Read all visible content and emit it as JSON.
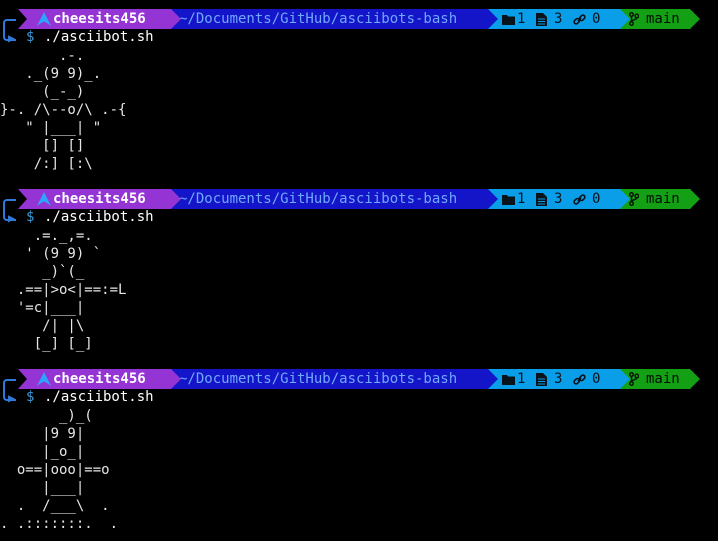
{
  "prompt": {
    "user": "cheesits456",
    "path": "~/Documents/GitHub/asciibots-bash",
    "git_folders": "1",
    "git_files": "3",
    "git_links": "0",
    "branch": "main",
    "symbol": "$"
  },
  "colors": {
    "user_segment": "#9434d4",
    "path_segment": "#1414c8",
    "path_text": "#6fa8ff",
    "git_segment": "#0a9ee8",
    "branch_segment": "#14a014",
    "connector": "#2f7ad9",
    "background": "#000000"
  },
  "icons": {
    "user_logo": "arch-linux-logo-icon",
    "folder": "folder-icon",
    "file": "file-icon",
    "link": "link-icon",
    "branch": "git-branch-icon"
  },
  "entries": [
    {
      "command": "./asciibot.sh",
      "art": "       .-.\n   ._(9 9)_.\n     (_-_)\n}-. /\\--o/\\ .-{\n   \" |___| \"\n     [] []\n    /:] [:\\"
    },
    {
      "command": "./asciibot.sh",
      "art": "    .=._,=.\n   ' (9 9) `\n     _)`(_\n  .==|>o<|==:=L\n  '=c|___|\n     /| |\\\n    [_] [_]"
    },
    {
      "command": "./asciibot.sh",
      "art": "       _)_(\n     |9 9|\n     |_o_|\n  o==|ooo|==o\n     |___|\n  .  /___\\  .\n. .:::::::.  ."
    }
  ]
}
